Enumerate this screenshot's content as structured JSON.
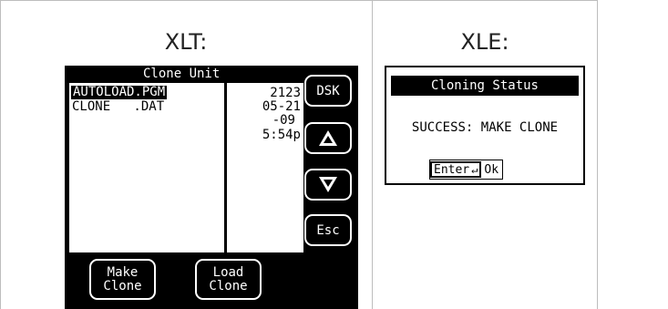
{
  "panels": {
    "xlt": {
      "heading": "XLT:",
      "title": "Clone Unit",
      "files": [
        {
          "name": "AUTOLOAD.PGM",
          "selected": true
        },
        {
          "name": "CLONE   .DAT",
          "selected": false
        }
      ],
      "date_lines": [
        "2123",
        "05-21",
        "-09",
        "5:54p"
      ],
      "side_buttons": {
        "dsk": "DSK",
        "esc": "Esc"
      },
      "bottom_buttons": {
        "make": [
          "Make",
          "Clone"
        ],
        "load": [
          "Load",
          "Clone"
        ]
      }
    },
    "xle": {
      "heading": "XLE:",
      "title": "Cloning Status",
      "message": "SUCCESS: MAKE CLONE",
      "enter_label": "Enter",
      "ok_label": "Ok"
    }
  },
  "colors": {
    "screen_bg": "#000000",
    "screen_fg": "#ffffff",
    "grid": "#bdbdbd"
  }
}
